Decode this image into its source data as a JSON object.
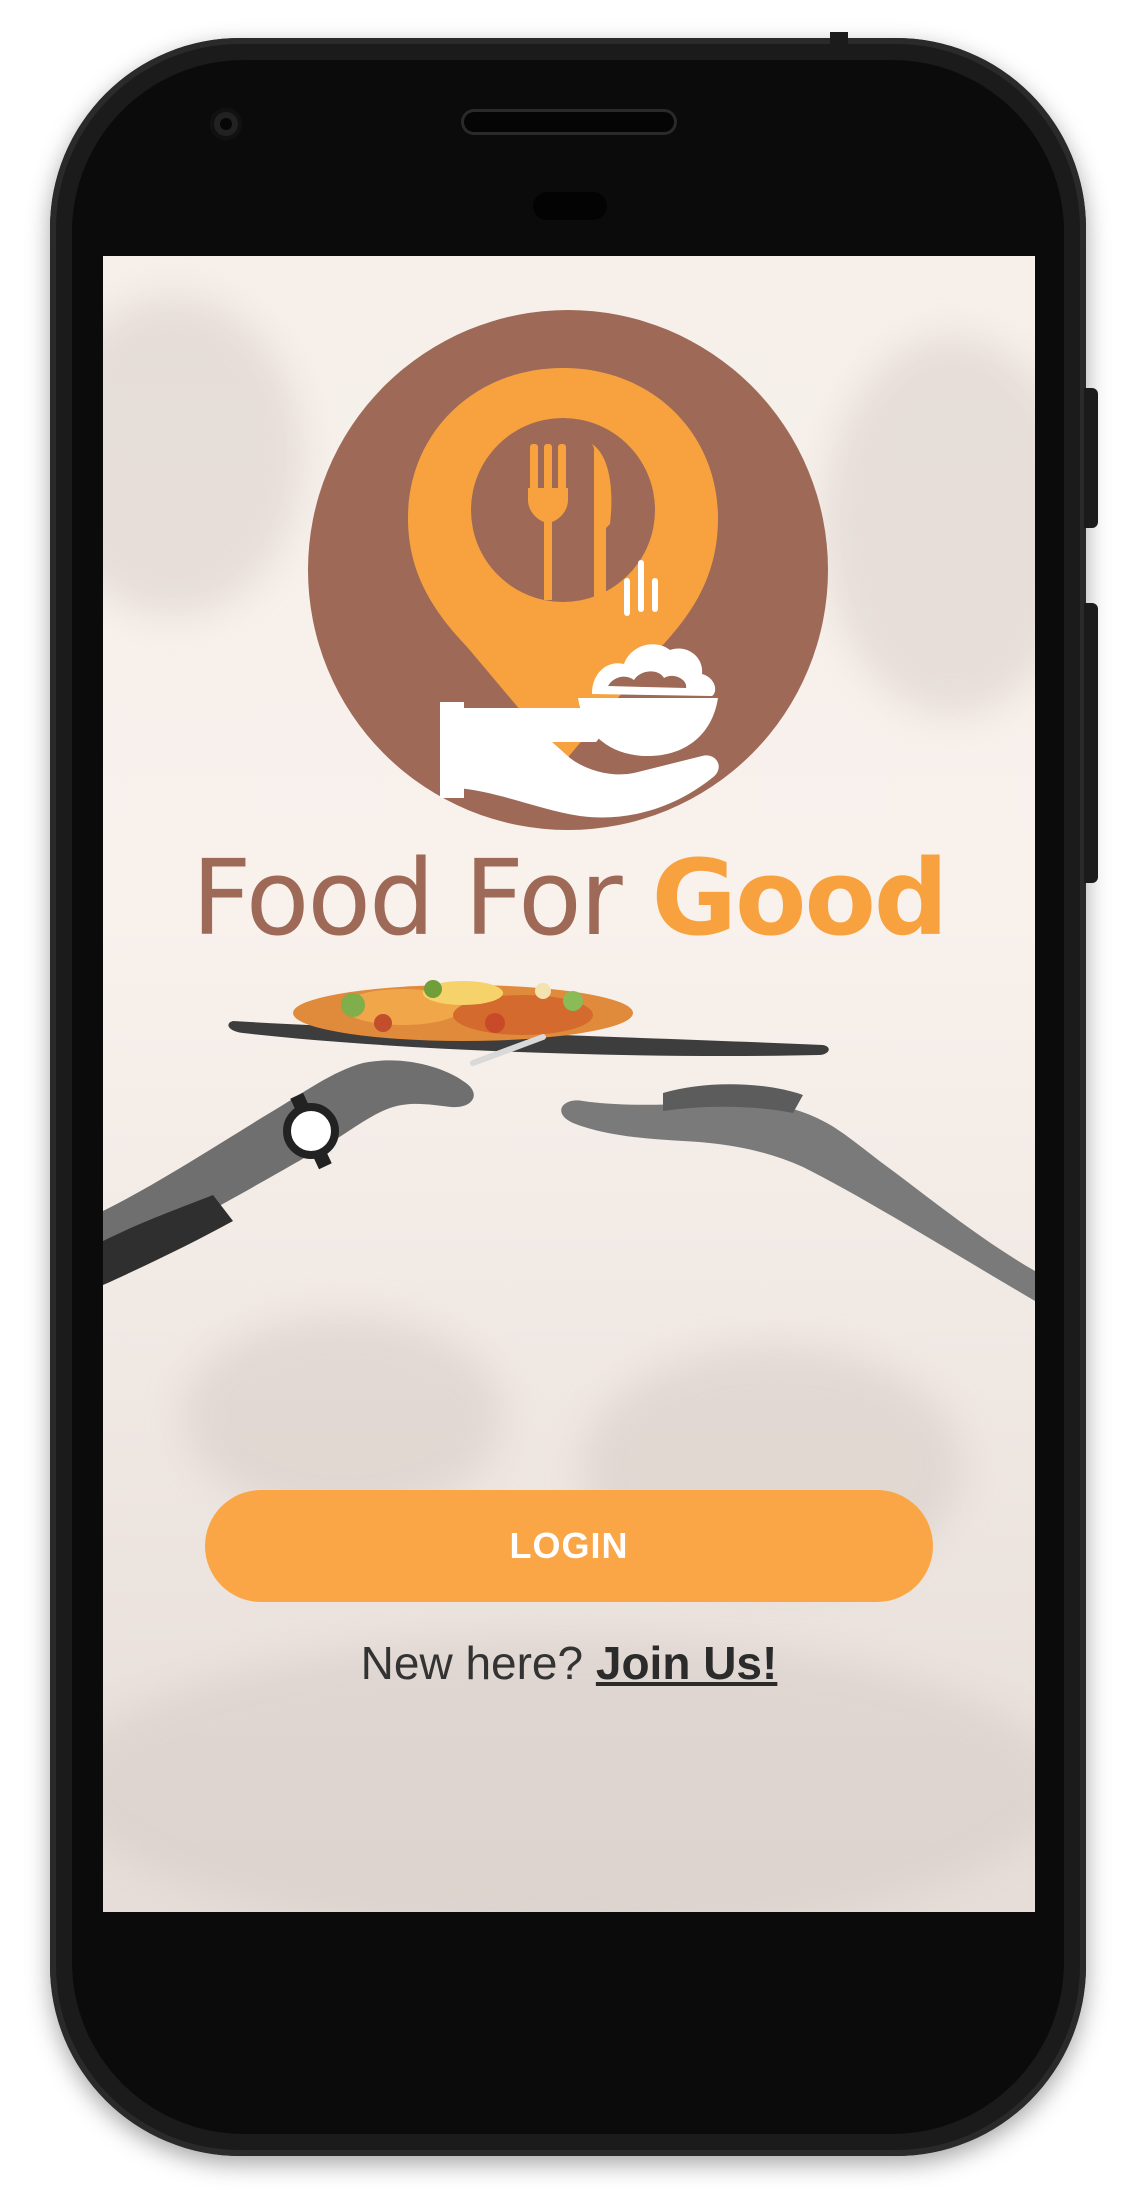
{
  "app": {
    "brand_part1": "Food For ",
    "brand_part2": "Good"
  },
  "actions": {
    "login_label": "LOGIN",
    "signup_prompt": "New here? ",
    "signup_link": "Join Us!"
  },
  "icons": {
    "logo": "food-for-good-logo",
    "illustration": "hands-sharing-food-plate"
  },
  "colors": {
    "brand_brown": "#9e6957",
    "brand_orange": "#f7a23f",
    "button_orange": "#fba646",
    "screen_background": "#f6efea"
  }
}
